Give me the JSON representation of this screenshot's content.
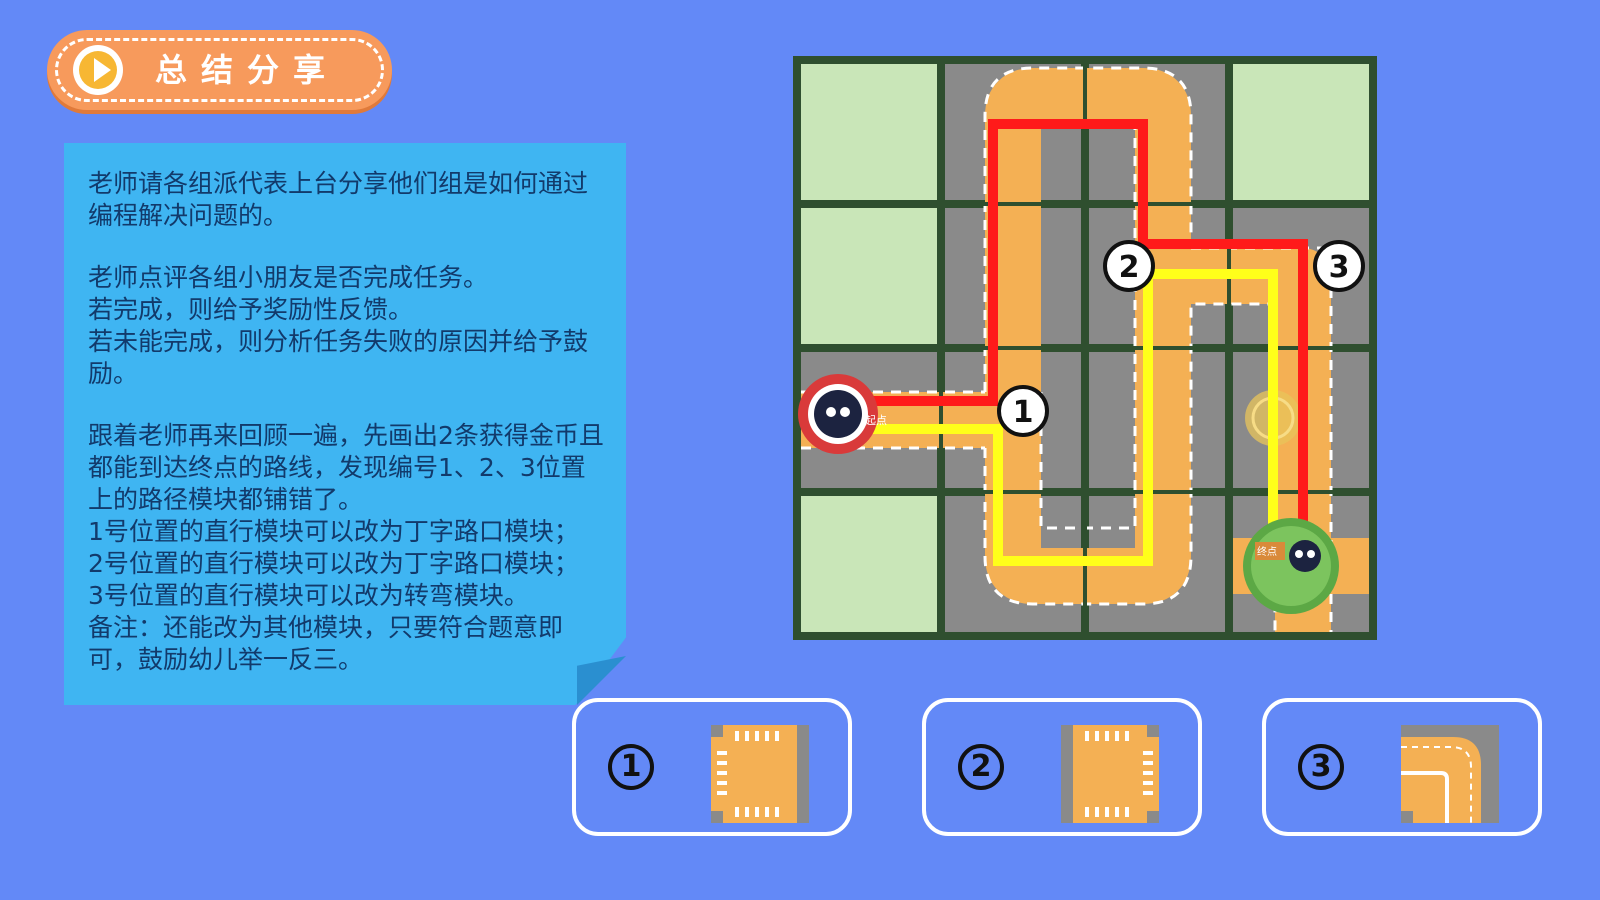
{
  "header": {
    "title": "总结分享",
    "icon": "play-icon",
    "color": "#f79a5c"
  },
  "note": {
    "paragraphs": [
      "老师请各组派代表上台分享他们组是如何通过编程解决问题的。",
      "老师点评各组小朋友是否完成任务。\n若完成，则给予奖励性反馈。\n若未能完成，则分析任务失败的原因并给予鼓励。",
      "跟着老师再来回顾一遍，先画出2条获得金币且都能到达终点的路线，发现编号1、2、3位置上的路径模块都铺错了。\n1号位置的直行模块可以改为丁字路口模块；\n2号位置的直行模块可以改为丁字路口模块；\n3号位置的直行模块可以改为转弯模块。\n备注：还能改为其他模块，只要符合题意即可，鼓励幼儿举一反三。"
    ],
    "color": "#3fb5f2"
  },
  "map": {
    "markers": [
      "1",
      "2",
      "3"
    ],
    "start_label": "起点",
    "end_label": "终点",
    "route_colors": [
      "#ff1a1a",
      "#ffff1a"
    ]
  },
  "tiles": [
    {
      "number": "1",
      "icon": "t-junction-tile-icon"
    },
    {
      "number": "2",
      "icon": "t-junction-tile-icon"
    },
    {
      "number": "3",
      "icon": "turn-tile-icon"
    }
  ]
}
